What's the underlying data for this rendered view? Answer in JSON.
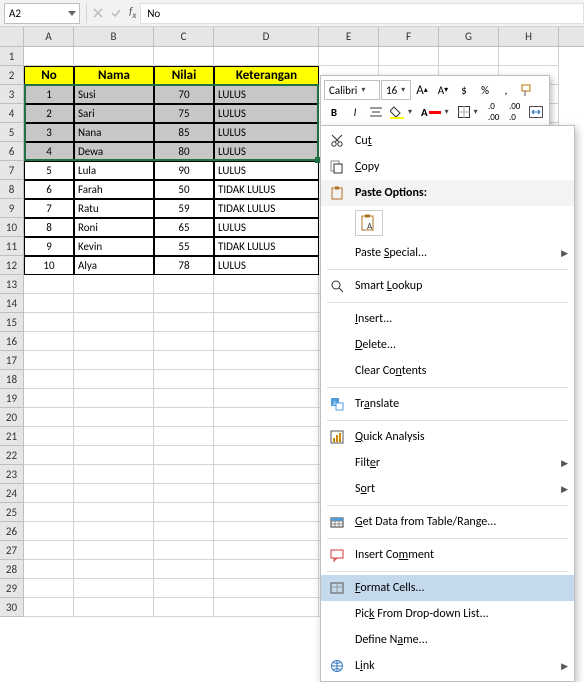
{
  "namebox": "A2",
  "formula_bar_value": "No",
  "font_name": "Calibri",
  "font_size": "16",
  "col_headers": [
    "A",
    "B",
    "C",
    "D",
    "E",
    "F",
    "G",
    "H"
  ],
  "table": {
    "headers": {
      "no": "No",
      "nama": "Nama",
      "nilai": "Nilai",
      "ket": "Keterangan"
    },
    "rows": [
      {
        "no": "1",
        "nama": "Susi",
        "nilai": "70",
        "ket": "LULUS"
      },
      {
        "no": "2",
        "nama": "Sari",
        "nilai": "75",
        "ket": "LULUS"
      },
      {
        "no": "3",
        "nama": "Nana",
        "nilai": "85",
        "ket": "LULUS"
      },
      {
        "no": "4",
        "nama": "Dewa",
        "nilai": "80",
        "ket": "LULUS"
      },
      {
        "no": "5",
        "nama": "Lula",
        "nilai": "90",
        "ket": "LULUS"
      },
      {
        "no": "6",
        "nama": "Farah",
        "nilai": "50",
        "ket": "TIDAK LULUS"
      },
      {
        "no": "7",
        "nama": "Ratu",
        "nilai": "59",
        "ket": "TIDAK LULUS"
      },
      {
        "no": "8",
        "nama": "Roni",
        "nilai": "65",
        "ket": "LULUS"
      },
      {
        "no": "9",
        "nama": "Kevin",
        "nilai": "55",
        "ket": "TIDAK LULUS"
      },
      {
        "no": "10",
        "nama": "Alya",
        "nilai": "78",
        "ket": "LULUS"
      }
    ]
  },
  "ctx": {
    "cut": "Cut",
    "copy": "Copy",
    "paste_options": "Paste Options:",
    "paste_special": "Paste Special...",
    "smart_lookup": "Smart Lookup",
    "insert": "Insert...",
    "delete": "Delete...",
    "clear": "Clear Contents",
    "translate": "Translate",
    "quick": "Quick Analysis",
    "filter": "Filter",
    "sort": "Sort",
    "getdata": "Get Data from Table/Range...",
    "comment": "Insert Comment",
    "format": "Format Cells...",
    "pick": "Pick From Drop-down List...",
    "define": "Define Name...",
    "link": "Link"
  },
  "mt": {
    "bold": "B",
    "italic": "I",
    "dollar": "$",
    "percent": "%",
    "comma": ","
  }
}
